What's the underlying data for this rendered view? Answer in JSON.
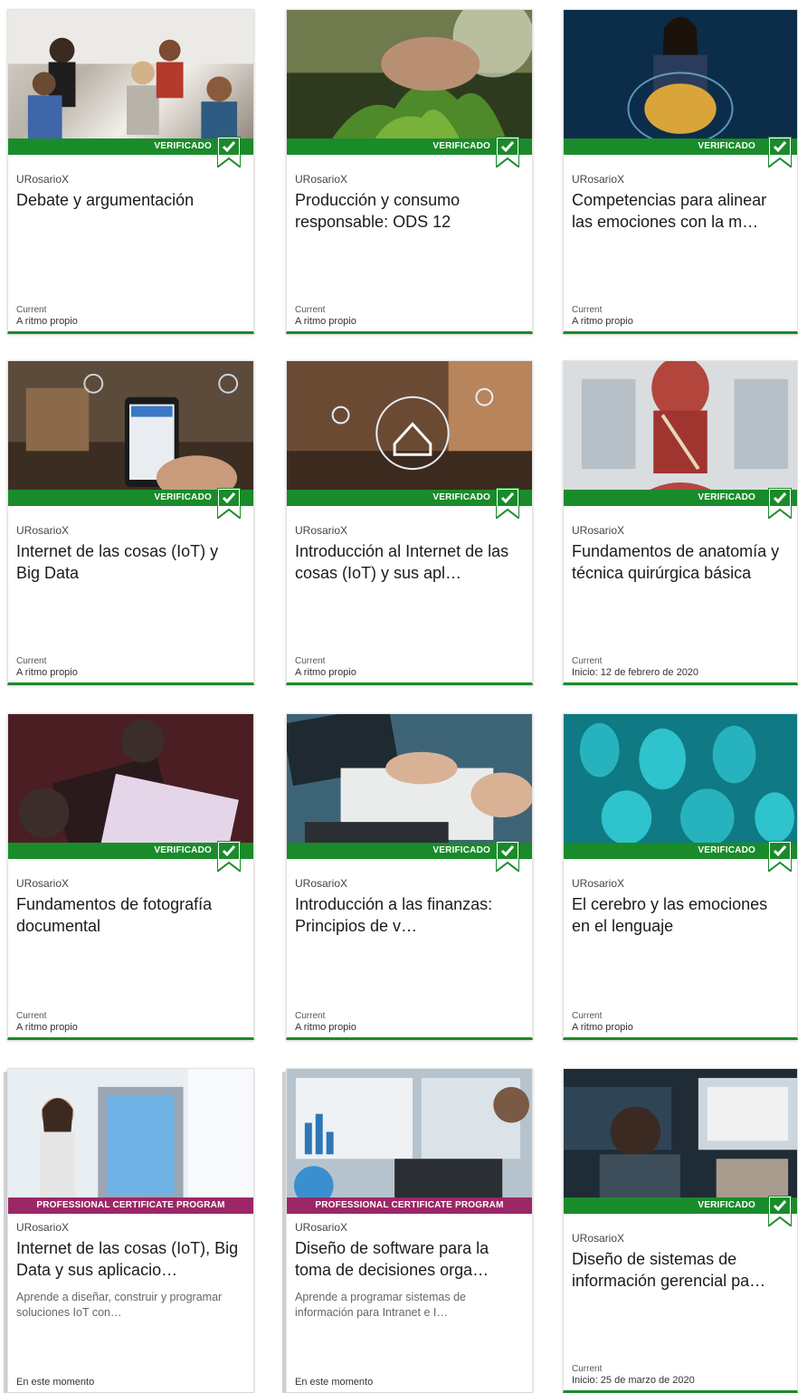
{
  "ribbons": {
    "verified": "VERIFICADO",
    "pcp": "PROFESSIONAL CERTIFICATE PROGRAM"
  },
  "colors": {
    "verified_green": "#1a8b2a",
    "program_magenta": "#9c2767"
  },
  "cards": [
    {
      "org": "URosarioX",
      "title": "Debate y argumentación",
      "status": "Current",
      "schedule": "A ritmo propio"
    },
    {
      "org": "URosarioX",
      "title": "Producción y consumo responsable: ODS 12",
      "status": "Current",
      "schedule": "A ritmo propio"
    },
    {
      "org": "URosarioX",
      "title": "Competencias para alinear las emociones con la m…",
      "status": "Current",
      "schedule": "A ritmo propio"
    },
    {
      "org": "URosarioX",
      "title": "Internet de las cosas (IoT) y Big Data",
      "status": "Current",
      "schedule": "A ritmo propio"
    },
    {
      "org": "URosarioX",
      "title": "Introducción al Internet de las cosas (IoT) y sus apl…",
      "status": "Current",
      "schedule": "A ritmo propio"
    },
    {
      "org": "URosarioX",
      "title": "Fundamentos de anatomía y técnica quirúrgica básica",
      "status": "Current",
      "schedule": "Inicio: 12 de febrero de 2020"
    },
    {
      "org": "URosarioX",
      "title": "Fundamentos de fotografía documental",
      "status": "Current",
      "schedule": "A ritmo propio"
    },
    {
      "org": "URosarioX",
      "title": "Introducción a las finanzas: Principios de v…",
      "status": "Current",
      "schedule": "A ritmo propio"
    },
    {
      "org": "URosarioX",
      "title": "El cerebro y las emociones en el lenguaje",
      "status": "Current",
      "schedule": "A ritmo propio"
    },
    {
      "org": "URosarioX",
      "title": "Internet de las cosas (IoT), Big Data y sus aplicacio…",
      "desc": "Aprende a diseñar, construir y programar soluciones IoT con…",
      "schedule": "En este momento"
    },
    {
      "org": "URosarioX",
      "title": "Diseño de software para la toma de decisiones orga…",
      "desc": "Aprende a programar sistemas de información para Intranet e I…",
      "schedule": "En este momento"
    },
    {
      "org": "URosarioX",
      "title": "Diseño de sistemas de información gerencial pa…",
      "status": "Current",
      "schedule": "Inicio: 25 de marzo de 2020"
    }
  ]
}
